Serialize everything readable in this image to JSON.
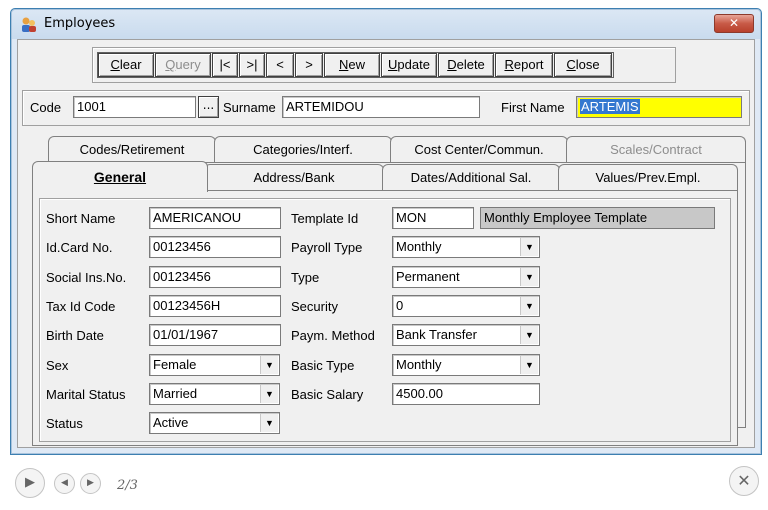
{
  "window": {
    "title": "Employees",
    "close_label": "✕"
  },
  "toolbar": {
    "buttons": [
      {
        "label": "Clear",
        "disabled": false
      },
      {
        "label": "Query",
        "disabled": true
      },
      {
        "label": "|<",
        "disabled": false
      },
      {
        "label": ">|",
        "disabled": false
      },
      {
        "label": "<",
        "disabled": false
      },
      {
        "label": ">",
        "disabled": false
      },
      {
        "label": "New",
        "disabled": false
      },
      {
        "label": "Update",
        "disabled": false
      },
      {
        "label": "Delete",
        "disabled": false
      },
      {
        "label": "Report",
        "disabled": false
      },
      {
        "label": "Close",
        "disabled": false
      }
    ]
  },
  "header": {
    "code_label": "Code",
    "code_value": "1001",
    "ellipsis_label": "...",
    "surname_label": "Surname",
    "surname_value": "ARTEMIDOU",
    "firstname_label": "First Name",
    "firstname_value": "ARTEMIS"
  },
  "tabs": {
    "back_row": [
      "Codes/Retirement",
      "Categories/Interf.",
      "Cost Center/Commun.",
      "Scales/Contract"
    ],
    "front_row": [
      "General",
      "Address/Bank",
      "Dates/Additional Sal.",
      "Values/Prev.Empl."
    ],
    "active": "General"
  },
  "general": {
    "left": [
      {
        "label": "Short Name",
        "value": "AMERICANOU",
        "dropdown": false
      },
      {
        "label": "Id.Card No.",
        "value": "00123456",
        "dropdown": false
      },
      {
        "label": "Social Ins.No.",
        "value": "00123456",
        "dropdown": false
      },
      {
        "label": "Tax Id Code",
        "value": "00123456H",
        "dropdown": false
      },
      {
        "label": "Birth Date",
        "value": "01/01/1967",
        "dropdown": false
      },
      {
        "label": "Sex",
        "value": "Female",
        "dropdown": true
      },
      {
        "label": "Marital Status",
        "value": "Married",
        "dropdown": true
      },
      {
        "label": "Status",
        "value": "Active",
        "dropdown": true
      }
    ],
    "right": [
      {
        "label": "Template Id",
        "value": "MON",
        "dropdown": false
      },
      {
        "label": "Payroll Type",
        "value": "Monthly",
        "dropdown": true
      },
      {
        "label": "Type",
        "value": "Permanent",
        "dropdown": true
      },
      {
        "label": "Security",
        "value": "0",
        "dropdown": true
      },
      {
        "label": "Paym. Method",
        "value": "Bank Transfer",
        "dropdown": true
      },
      {
        "label": "Basic Type",
        "value": "Monthly",
        "dropdown": true
      },
      {
        "label": "Basic Salary",
        "value": "4500.00",
        "dropdown": false
      }
    ],
    "template_description": "Monthly Employee Template"
  },
  "viewer": {
    "page_indicator": "2/3"
  }
}
